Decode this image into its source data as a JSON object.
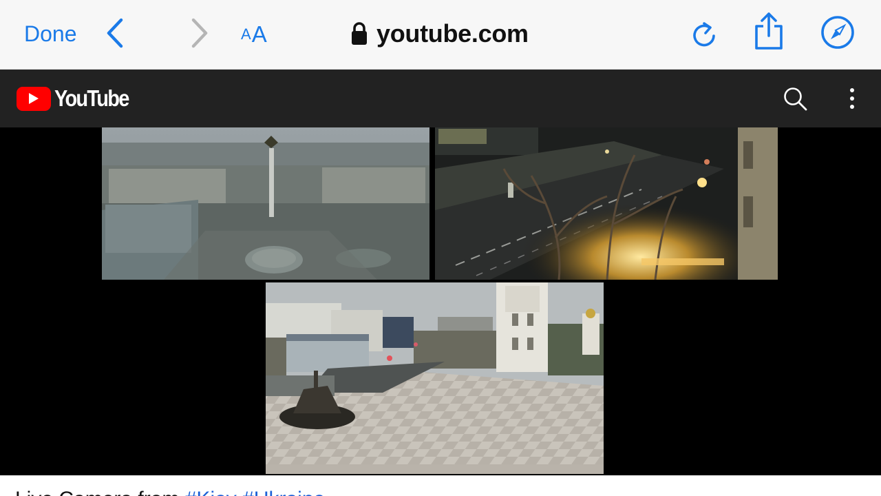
{
  "browser": {
    "done_label": "Done",
    "aa_small": "A",
    "aa_big": "A",
    "host": "youtube.com",
    "accent_color": "#1a7ae8",
    "icons": [
      "back-chevron-icon",
      "forward-chevron-icon",
      "lock-icon",
      "reload-icon",
      "share-icon",
      "compass-icon"
    ]
  },
  "youtube": {
    "wordmark": "YouTube",
    "brand_color": "#ff0000",
    "header_color": "#222222",
    "icons": [
      "search-icon",
      "more-vertical-icon"
    ]
  },
  "video": {
    "feeds": [
      "Maidan Nezalezhnosti square camera",
      "night street camera",
      "Sofia square camera"
    ]
  },
  "title": {
    "text": "Live Camera from",
    "tags": [
      "#Kiev",
      "#Ukraine"
    ]
  }
}
